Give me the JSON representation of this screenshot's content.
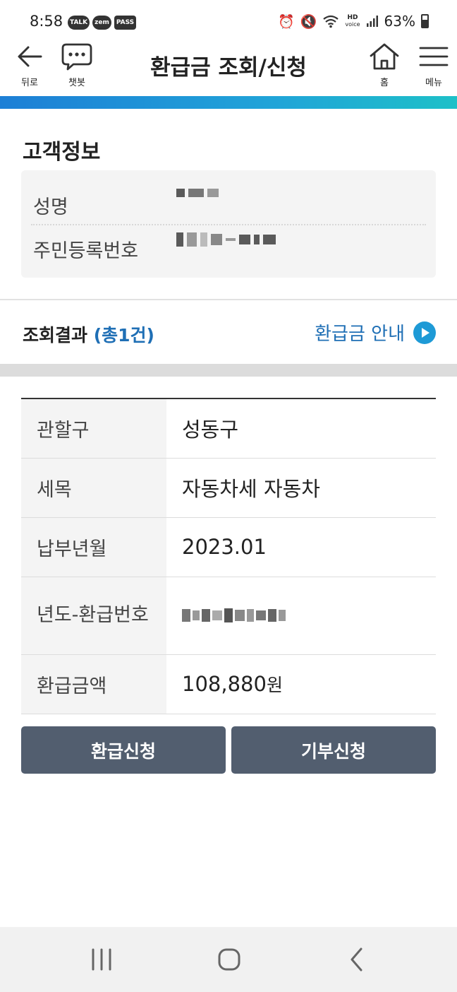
{
  "status_bar": {
    "time": "8:58",
    "app_badges": [
      "TALK",
      "zem",
      "PASS"
    ],
    "icons": [
      "alarm-icon",
      "mute-icon",
      "wifi-icon",
      "hd-voice-icon",
      "signal-icon",
      "battery-icon"
    ],
    "hd_voice_top": "HD",
    "hd_voice_bottom": "voice",
    "battery_percent": "63%"
  },
  "header": {
    "title": "환급금 조회/신청",
    "back_label": "뒤로",
    "chatbot_label": "챗봇",
    "home_label": "홈",
    "menu_label": "메뉴"
  },
  "customer": {
    "title": "고객정보",
    "name_label": "성명",
    "rrn_label": "주민등록번호"
  },
  "results": {
    "title": "조회결과",
    "count": "(총1건)",
    "guide_link": "환급금 안내",
    "rows": {
      "district_label": "관할구",
      "district_value": "성동구",
      "tax_item_label": "세목",
      "tax_item_value": "자동차세 자동차",
      "pay_month_label": "납부년월",
      "pay_month_value": "2023.01",
      "refund_no_label": "년도-환급번호",
      "amount_label": "환급금액",
      "amount_value": "108,880",
      "amount_unit": "원"
    }
  },
  "actions": {
    "refund_button": "환급신청",
    "donate_button": "기부신청"
  },
  "colors": {
    "accent_blue": "#1f6fb5",
    "button_bg": "#525e6f",
    "gradient_start": "#1d7fd6",
    "gradient_end": "#1ec0c8"
  }
}
